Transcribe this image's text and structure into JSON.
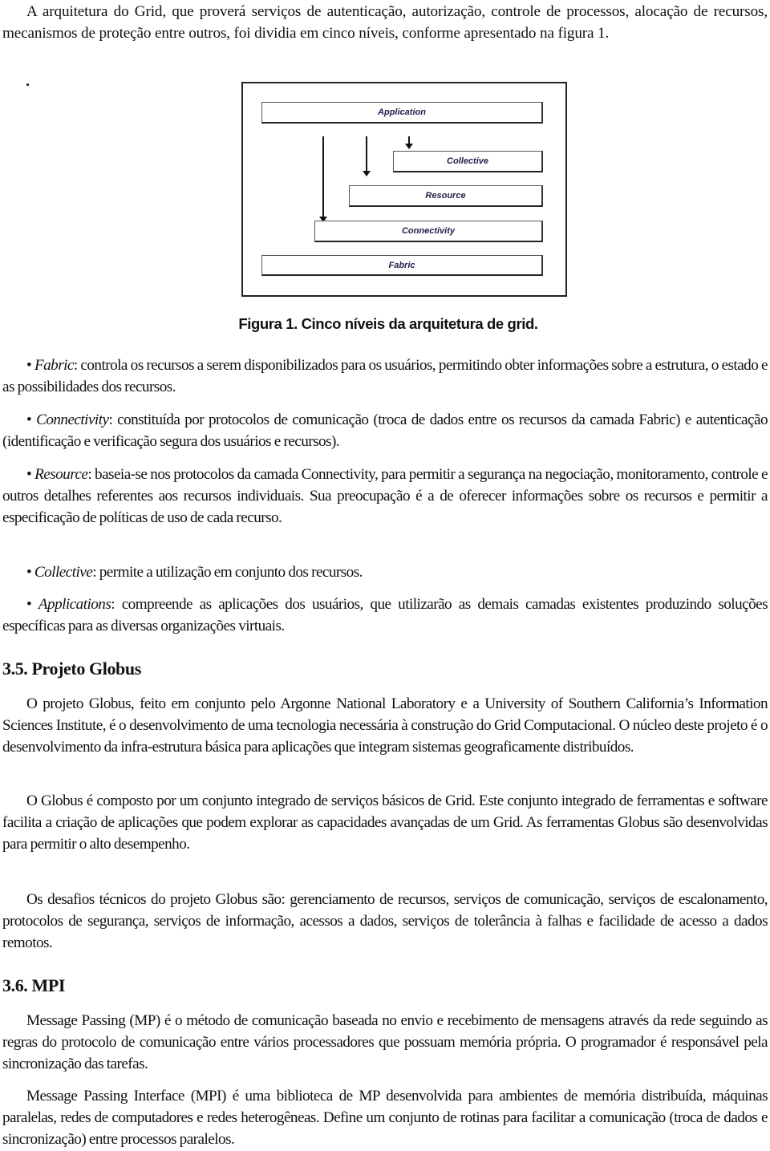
{
  "intro": {
    "text": "A arquitetura do Grid, que proverá serviços de autenticação, autorização, controle de processos, alocação de recursos, mecanismos de proteção entre outros, foi dividia em cinco níveis, conforme apresentado na figura 1."
  },
  "figure": {
    "layers": [
      "Application",
      "Collective",
      "Resource",
      "Connectivity",
      "Fabric"
    ],
    "caption": "Figura 1. Cinco níveis da arquitetura de grid."
  },
  "bullets": [
    {
      "term": "Fabric",
      "text": ": controla os recursos a serem disponibilizados para os usuários, permitindo obter informações sobre a estrutura, o estado e as possibilidades dos recursos."
    },
    {
      "term": "Connectivity",
      "text": ": constituída por protocolos de comunicação (troca de dados entre os recursos da camada Fabric) e autenticação (identificação e verificação segura dos usuários e recursos)."
    },
    {
      "term": "Resource",
      "text": ": baseia-se nos protocolos da camada Connectivity, para permitir a segurança na negociação, monitoramento, controle e outros detalhes referentes aos recursos individuais. Sua preocupação é a de oferecer informações sobre os recursos e permitir a especificação de políticas de uso de cada recurso."
    },
    {
      "term": "Collective",
      "text": ": permite a utilização em conjunto dos recursos."
    },
    {
      "term": "Applications",
      "text": ": compreende as aplicações dos usuários, que utilizarão as demais camadas existentes produzindo soluções específicas para as diversas organizações virtuais."
    }
  ],
  "bullet_symbol": "•",
  "sections": [
    {
      "heading": "3.5. Projeto Globus",
      "paragraphs": [
        "O projeto Globus, feito em conjunto pelo Argonne National Laboratory e a University of Southern California’s Information Sciences Institute, é o desenvolvimento de uma tecnologia necessária à construção do Grid Computacional. O núcleo deste projeto é o desenvolvimento da infra-estrutura básica para aplicações que integram sistemas geograficamente distribuídos.",
        "O Globus é composto por um conjunto integrado de serviços básicos de Grid. Este conjunto integrado de ferramentas e software facilita a criação de aplicações que podem explorar as capacidades avançadas de um Grid. As ferramentas Globus são desenvolvidas para permitir o alto desempenho.",
        "Os desafios técnicos do projeto Globus são: gerenciamento de recursos, serviços de comunicação, serviços de escalonamento, protocolos de segurança, serviços de informação, acessos a dados, serviços de tolerância à falhas e facilidade de acesso a dados remotos."
      ]
    },
    {
      "heading": "3.6. MPI",
      "paragraphs": [
        "Message Passing (MP) é o método de comunicação baseada no envio e recebimento de mensagens através da rede seguindo as regras do protocolo de comunicação entre vários processadores que possuam memória própria. O programador é responsável pela sincronização das tarefas.",
        "Message Passing Interface (MPI) é uma biblioteca de MP desenvolvida para ambientes de memória distribuída, máquinas paralelas, redes de computadores e redes heterogêneas.  Define um conjunto de rotinas para facilitar a comunicação (troca de dados e sincronização) entre processos paralelos."
      ]
    }
  ]
}
